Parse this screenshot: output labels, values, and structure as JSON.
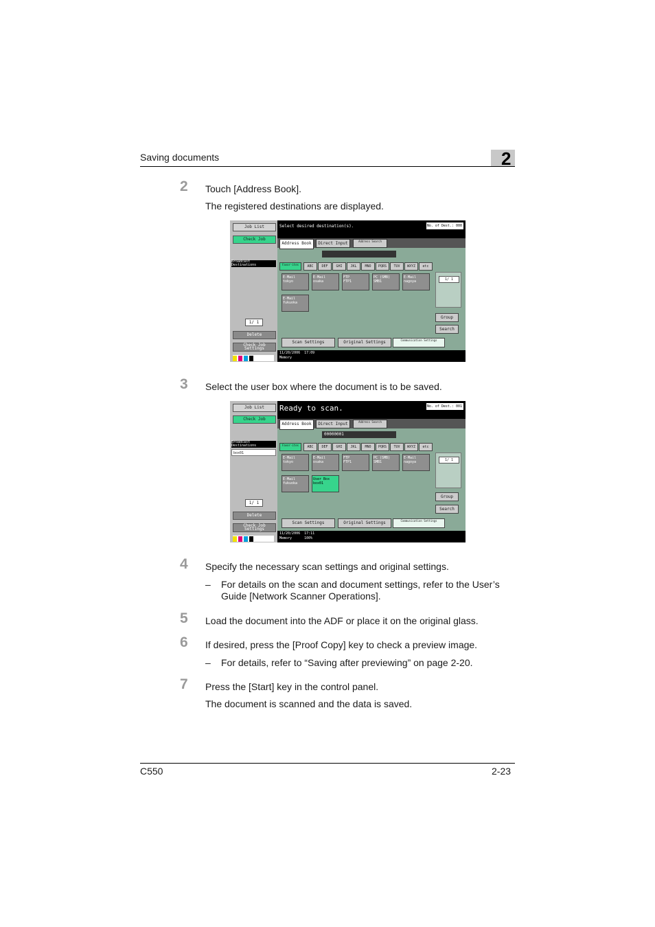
{
  "header": {
    "title": "Saving documents",
    "chapter": "2"
  },
  "steps": [
    {
      "num": "2",
      "text": "Touch [Address Book].",
      "note": "The registered destinations are displayed."
    },
    {
      "num": "3",
      "text": "Select the user box where the document is to be saved."
    },
    {
      "num": "4",
      "text": "Specify the necessary scan settings and original settings.",
      "sub": "For details on the scan and document settings, refer to the User’s Guide [Network Scanner Operations]."
    },
    {
      "num": "5",
      "text": "Load the document into the ADF or place it on the original glass."
    },
    {
      "num": "6",
      "text": "If desired, press the [Proof Copy] key to check a preview image.",
      "sub": "For details, refer to “Saving after previewing” on page 2-20."
    },
    {
      "num": "7",
      "text": "Press the [Start] key in the control panel.",
      "note": "The document is scanned and the data is saved."
    }
  ],
  "dash": "–",
  "screens": [
    {
      "message": "Select desired destination(s).",
      "counter": "No. of Dest.:   000",
      "input": "",
      "user_row": "",
      "destinations": [
        {
          "type": "E-Mail",
          "name": "tokyo"
        },
        {
          "type": "E-Mail",
          "name": "osaka"
        },
        {
          "type": "FTP",
          "name": "FTP1"
        },
        {
          "type": "PC (SMB)",
          "name": "SMB1"
        },
        {
          "type": "E-Mail",
          "name": "nagoya"
        },
        {
          "type": "E-Mail",
          "name": "fukuoka"
        }
      ],
      "status": {
        "date": "11/20/2006",
        "time": "17:09",
        "mode": "Memory",
        "pct": ""
      }
    },
    {
      "message": "Ready to scan.",
      "counter": "No. of Dest.:   001",
      "input": "00000001",
      "user_row": "box01",
      "destinations": [
        {
          "type": "E-Mail",
          "name": "tokyo"
        },
        {
          "type": "E-Mail",
          "name": "osaka"
        },
        {
          "type": "FTP",
          "name": "FTP1"
        },
        {
          "type": "PC (SMB)",
          "name": "SMB1"
        },
        {
          "type": "E-Mail",
          "name": "nagoya"
        },
        {
          "type": "E-Mail",
          "name": "fukuoka"
        },
        {
          "type": "User Box",
          "name": "box01"
        }
      ],
      "status": {
        "date": "11/20/2006",
        "time": "17:11",
        "mode": "Memory",
        "pct": "100%"
      }
    }
  ],
  "ui": {
    "job_list": "Job List",
    "check_job": "Check Job",
    "broadcast": "Broadcast Destinations",
    "page": "1/ 1",
    "delete": "Delete",
    "check_settings": "Check Job Settings",
    "tabs": [
      "Address Book",
      "Direct Input",
      "Address Search"
    ],
    "index": [
      "Favor-ites",
      "ABC",
      "DEF",
      "GHI",
      "JKL",
      "MNO",
      "PQRS",
      "TUV",
      "WXYZ",
      "etc"
    ],
    "group": "Group",
    "search": "Search",
    "scan_settings": "Scan Settings",
    "original_settings": "Original Settings",
    "comm_settings": "Communication Settings",
    "ymck": [
      "Y",
      "M",
      "C",
      "K"
    ]
  },
  "footer": {
    "model": "C550",
    "page": "2-23"
  }
}
